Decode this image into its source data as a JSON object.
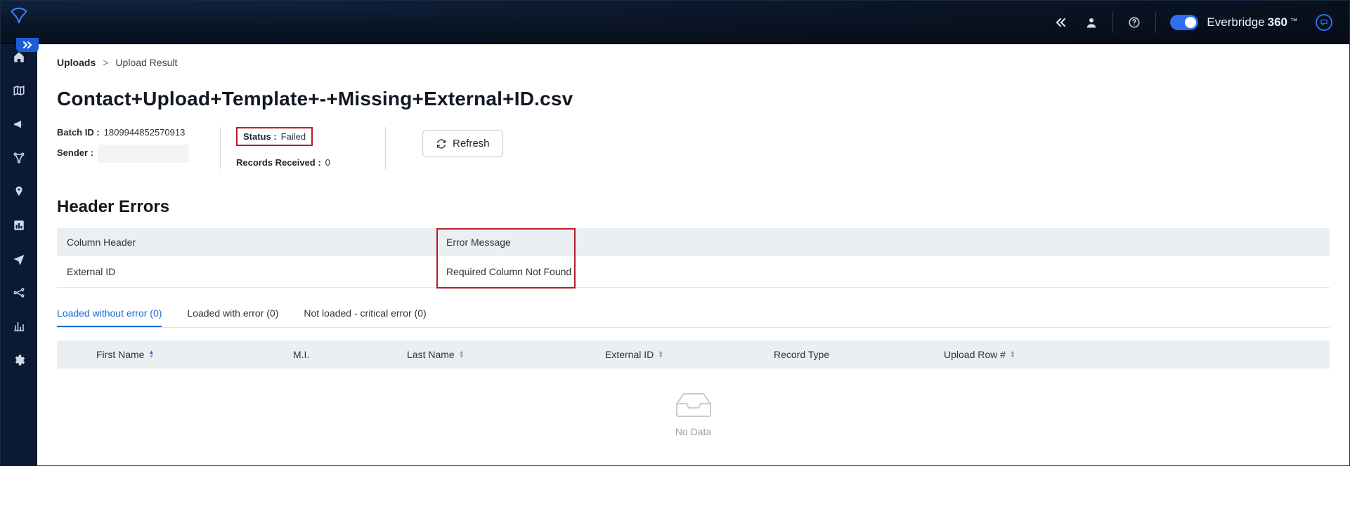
{
  "brand": {
    "name_regular": "Everbridge ",
    "name_bold": "360",
    "tm": "™"
  },
  "breadcrumb": {
    "root": "Uploads",
    "sep": ">",
    "current": "Upload Result"
  },
  "page": {
    "title": "Contact+Upload+Template+-+Missing+External+ID.csv",
    "batch_id_label": "Batch ID :",
    "batch_id_value": "1809944852570913",
    "sender_label": "Sender :",
    "status_label": "Status :",
    "status_value": "Failed",
    "records_label": "Records Received :",
    "records_value": "0"
  },
  "buttons": {
    "refresh": "Refresh"
  },
  "header_errors": {
    "title": "Header Errors",
    "col_header": "Column Header",
    "col_error": "Error Message",
    "rows": [
      {
        "header": "External ID",
        "message": "Required Column Not Found"
      }
    ]
  },
  "tabs": {
    "loaded_ok": "Loaded without error (0)",
    "loaded_err": "Loaded with error (0)",
    "not_loaded": "Not loaded - critical error (0)"
  },
  "grid": {
    "first_name": "First Name",
    "mi": "M.I.",
    "last_name": "Last Name",
    "external_id": "External ID",
    "record_type": "Record Type",
    "upload_row": "Upload Row #",
    "no_data": "No Data"
  },
  "colors": {
    "accent": "#1769d5",
    "danger": "#b4202a"
  }
}
